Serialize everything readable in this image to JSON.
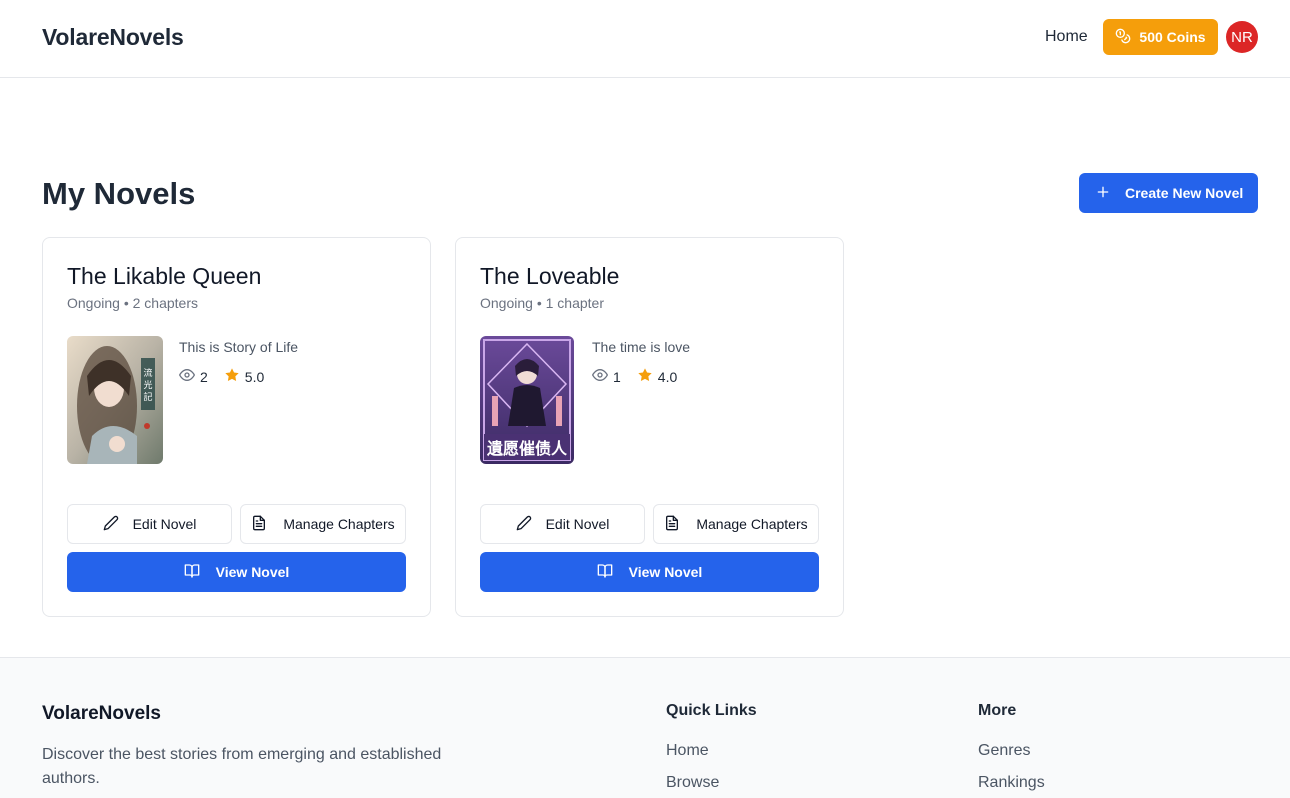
{
  "header": {
    "brand": "VolareNovels",
    "nav_home": "Home",
    "coins_label": "500 Coins",
    "avatar_initials": "NR"
  },
  "main": {
    "title": "My Novels",
    "create_button": "Create New Novel",
    "novels": [
      {
        "title": "The Likable Queen",
        "meta": "Ongoing • 2 chapters",
        "description": "This is Story of Life",
        "views": "2",
        "rating": "5.0",
        "edit_label": "Edit Novel",
        "manage_label": "Manage Chapters",
        "view_label": "View Novel"
      },
      {
        "title": "The Loveable",
        "meta": "Ongoing • 1 chapter",
        "description": "The time is love",
        "views": "1",
        "rating": "4.0",
        "edit_label": "Edit Novel",
        "manage_label": "Manage Chapters",
        "view_label": "View Novel"
      }
    ]
  },
  "footer": {
    "brand": "VolareNovels",
    "description": "Discover the best stories from emerging and established authors.",
    "quick_links": {
      "title": "Quick Links",
      "items": [
        "Home",
        "Browse"
      ]
    },
    "more": {
      "title": "More",
      "items": [
        "Genres",
        "Rankings"
      ]
    }
  },
  "colors": {
    "primary": "#2563eb",
    "coins": "#f59e0b",
    "avatar": "#dc2626",
    "star": "#f59e0b"
  },
  "icons": [
    "coins-icon",
    "plus-icon",
    "eye-icon",
    "star-icon",
    "pencil-icon",
    "file-text-icon",
    "book-open-icon"
  ]
}
